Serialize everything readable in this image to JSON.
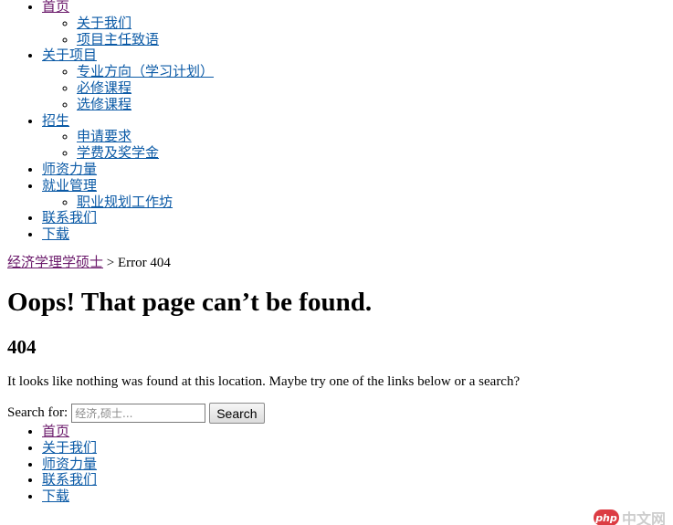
{
  "top_nav": [
    {
      "label": "首页",
      "visited": true,
      "children": [
        {
          "label": "关于我们"
        },
        {
          "label": "项目主任致语"
        }
      ]
    },
    {
      "label": "关于项目",
      "children": [
        {
          "label": "专业方向（学习计划）"
        },
        {
          "label": "必修课程"
        },
        {
          "label": "选修课程"
        }
      ]
    },
    {
      "label": "招生",
      "children": [
        {
          "label": "申请要求"
        },
        {
          "label": "学费及奖学金"
        }
      ]
    },
    {
      "label": "师资力量",
      "children": []
    },
    {
      "label": "就业管理",
      "children": [
        {
          "label": "职业规划工作坊"
        }
      ]
    },
    {
      "label": "联系我们",
      "children": []
    },
    {
      "label": "下载",
      "children": []
    }
  ],
  "breadcrumb": {
    "home": "经济学理学硕士",
    "separator": " > ",
    "current": "Error 404"
  },
  "error": {
    "title": "Oops! That page can’t be found.",
    "code": "404",
    "message": "It looks like nothing was found at this location. Maybe try one of the links below or a search?"
  },
  "search": {
    "label": "Search for:",
    "placeholder": "经济,硕士...",
    "value": "",
    "button": "Search"
  },
  "footer_nav": [
    {
      "label": "首页",
      "visited": true
    },
    {
      "label": "关于我们"
    },
    {
      "label": "师资力量"
    },
    {
      "label": "联系我们"
    },
    {
      "label": "下载"
    }
  ],
  "watermark": {
    "badge": "php",
    "text": "中文网"
  },
  "colors": {
    "link": "#0b5aa6",
    "visited": "#6b1a6b"
  }
}
